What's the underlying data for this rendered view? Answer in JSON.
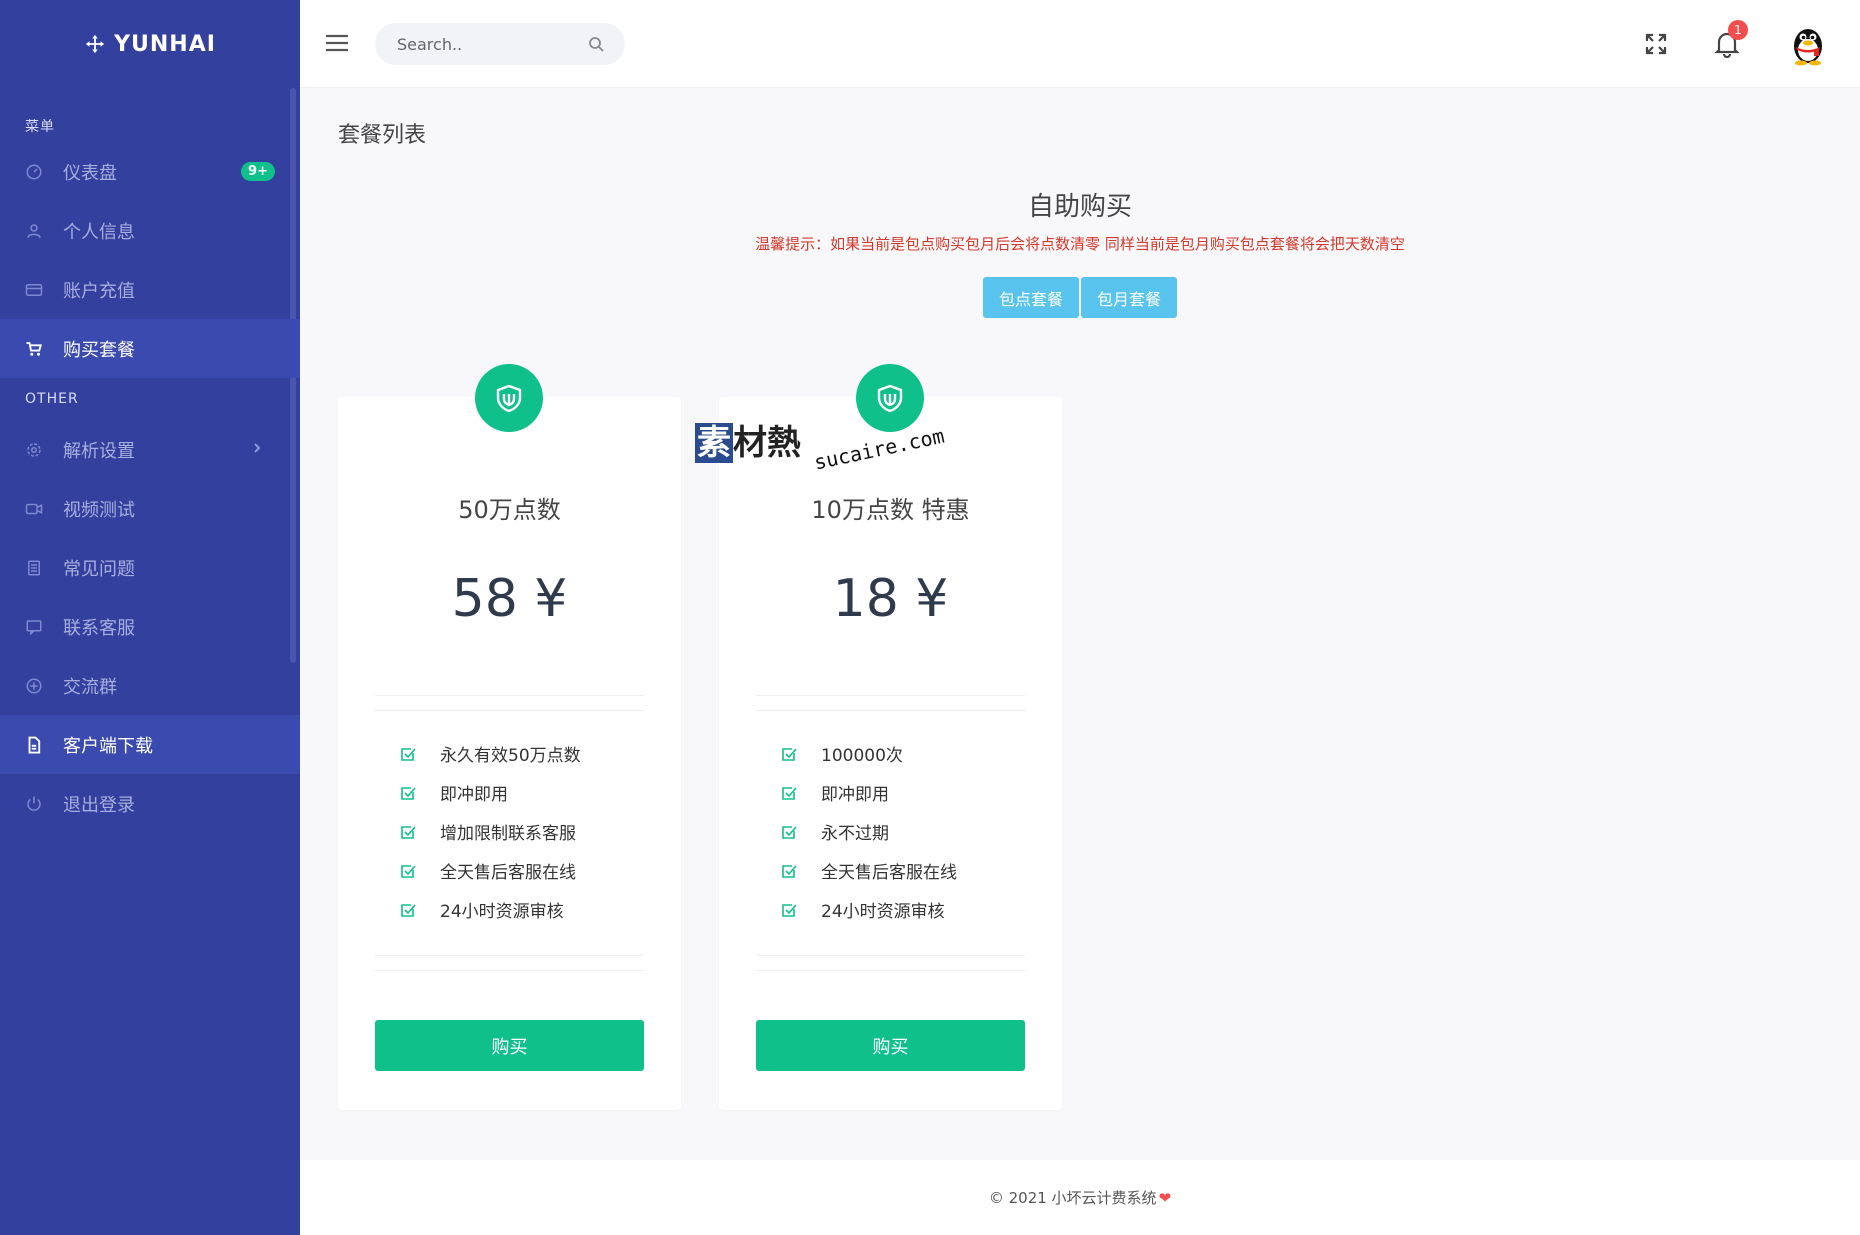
{
  "brand": {
    "name": "YUNHAI"
  },
  "sidebar": {
    "section1_title": "菜单",
    "section2_title": "OTHER",
    "items": [
      {
        "label": "仪表盘",
        "icon": "dashboard-icon",
        "badge": "9+"
      },
      {
        "label": "个人信息",
        "icon": "user-icon"
      },
      {
        "label": "账户充值",
        "icon": "credit-card-icon"
      },
      {
        "label": "购买套餐",
        "icon": "cart-icon",
        "active": true
      },
      {
        "label": "解析设置",
        "icon": "gear-icon",
        "has_submenu": true
      },
      {
        "label": "视频测试",
        "icon": "video-icon"
      },
      {
        "label": "常见问题",
        "icon": "document-icon"
      },
      {
        "label": "联系客服",
        "icon": "chat-icon"
      },
      {
        "label": "交流群",
        "icon": "plus-circle-icon"
      },
      {
        "label": "客户端下载",
        "icon": "file-icon",
        "active": true
      },
      {
        "label": "退出登录",
        "icon": "power-icon"
      }
    ]
  },
  "topbar": {
    "search_placeholder": "Search..",
    "notification_count": "1"
  },
  "main": {
    "page_title": "套餐列表",
    "section_title": "自助购买",
    "warning": "温馨提示：如果当前是包点购买包月后会将点数清零 同样当前是包月购买包点套餐将会把天数清空",
    "tabs": [
      {
        "label": "包点套餐"
      },
      {
        "label": "包月套餐"
      }
    ],
    "plans": [
      {
        "name": "50万点数",
        "price": "58 ¥",
        "features": [
          "永久有效50万点数",
          "即冲即用",
          "增加限制联系客服",
          "全天售后客服在线",
          "24小时资源审核"
        ],
        "button": "购买"
      },
      {
        "name": "10万点数 特惠",
        "price": "18 ¥",
        "features": [
          "100000次",
          "即冲即用",
          "永不过期",
          "全天售后客服在线",
          "24小时资源审核"
        ],
        "button": "购买"
      }
    ]
  },
  "watermark": {
    "cn_first": "素",
    "cn_rest": "材熱",
    "en": "sucaire.com"
  },
  "footer": {
    "text": "© 2021 小坏云计费系统",
    "heart": "❤"
  },
  "colors": {
    "sidebar_bg": "#33409e",
    "accent_green": "#10c08a",
    "tab_blue": "#58c4ee",
    "warning_red": "#d33a2c"
  }
}
